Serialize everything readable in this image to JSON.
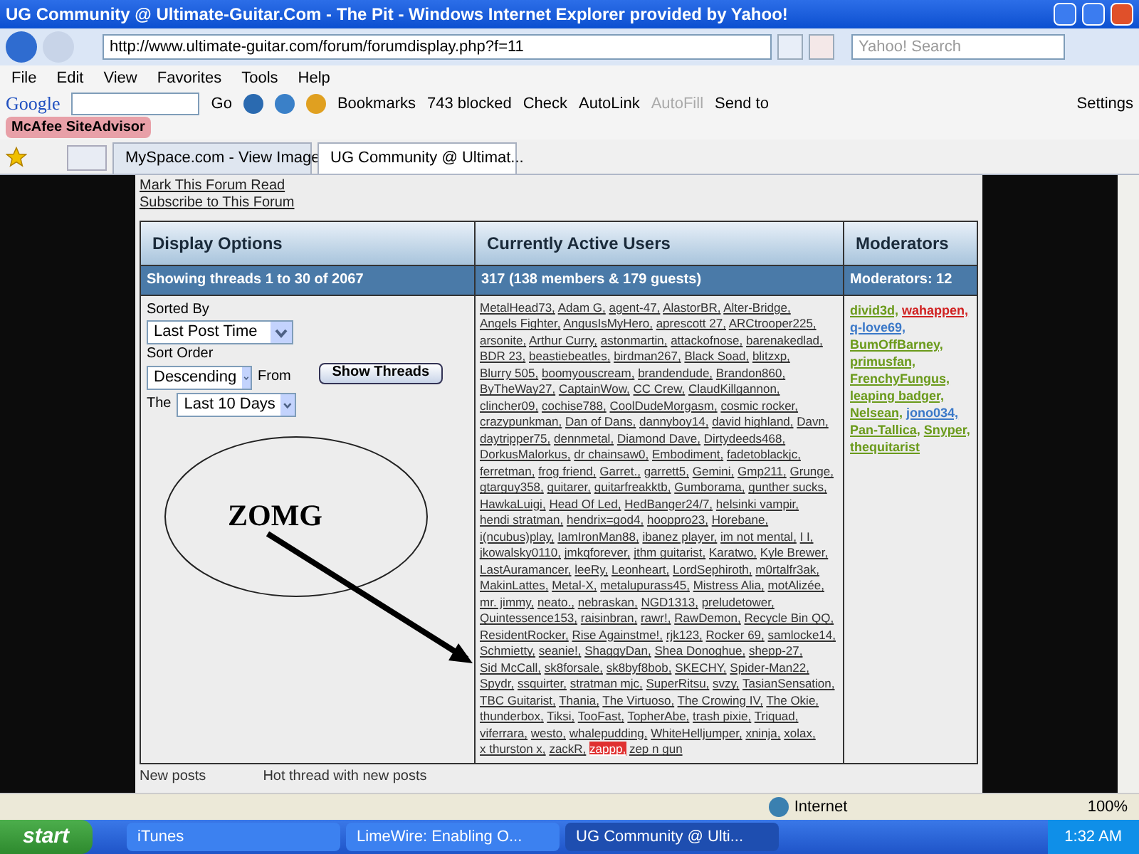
{
  "window": {
    "title": "UG Community @ Ultimate-Guitar.Com - The Pit - Windows Internet Explorer provided by Yahoo!"
  },
  "address_bar": {
    "url": "http://www.ultimate-guitar.com/forum/forumdisplay.php?f=11",
    "search_placeholder": "Yahoo! Search"
  },
  "menu": [
    "File",
    "Edit",
    "View",
    "Favorites",
    "Tools",
    "Help"
  ],
  "google_toolbar": {
    "logo": "Google",
    "go": "Go",
    "items": [
      {
        "label": "Bookmarks",
        "disabled": false
      },
      {
        "label": "743 blocked",
        "disabled": false
      },
      {
        "label": "Check",
        "disabled": false
      },
      {
        "label": "AutoLink",
        "disabled": false
      },
      {
        "label": "AutoFill",
        "disabled": true
      },
      {
        "label": "Send to",
        "disabled": false
      }
    ],
    "settings": "Settings"
  },
  "mcafee": "McAfee SiteAdvisor",
  "tabs": [
    {
      "label": "MySpace.com - View Image",
      "selected": false
    },
    {
      "label": "UG Community @ Ultimat...",
      "selected": true
    }
  ],
  "forum": {
    "links": [
      "Mark This Forum Read",
      "Subscribe to This Forum"
    ],
    "columns": [
      {
        "title": "Display Options",
        "sub": "Showing threads 1 to 30 of 2067"
      },
      {
        "title": "Currently Active Users",
        "sub": "317 (138 members & 179 guests)"
      },
      {
        "title": "Moderators",
        "sub": "Moderators: 12"
      }
    ],
    "display_options": {
      "sorted_by_label": "Sorted By",
      "sorted_by": "Last Post Time",
      "sort_order_label": "Sort Order",
      "sort_order": "Descending",
      "from_label": "From",
      "the_label": "The",
      "range": "Last 10 Days",
      "button": "Show Threads"
    },
    "users": [
      {
        "name": "MetalHead73,"
      },
      {
        "name": "Adam G,"
      },
      {
        "name": "agent-47,"
      },
      {
        "name": "AlastorBR,"
      },
      {
        "name": "Alter-Bridge,"
      },
      {
        "name": "Angels Fighter,"
      },
      {
        "name": "AngusIsMyHero,"
      },
      {
        "name": "aprescott 27,"
      },
      {
        "name": "ARCtrooper225,"
      },
      {
        "name": "arsonite,"
      },
      {
        "name": "Arthur Curry,"
      },
      {
        "name": "astonmartin,"
      },
      {
        "name": "attackofnose,"
      },
      {
        "name": "barenakedlad,"
      },
      {
        "name": "BDR 23,"
      },
      {
        "name": "beastiebeatles,"
      },
      {
        "name": "birdman267,"
      },
      {
        "name": "Black Soad,"
      },
      {
        "name": "blitzxp,"
      },
      {
        "name": "Blurry 505,"
      },
      {
        "name": "boomyouscream,"
      },
      {
        "name": "brandendude,"
      },
      {
        "name": "Brandon860,"
      },
      {
        "name": "ByTheWay27,"
      },
      {
        "name": "CaptainWow,"
      },
      {
        "name": "CC Crew,"
      },
      {
        "name": "ClaudKillgannon,"
      },
      {
        "name": "clincher09,"
      },
      {
        "name": "cochise788,"
      },
      {
        "name": "CoolDudeMorgasm,"
      },
      {
        "name": "cosmic rocker,"
      },
      {
        "name": "crazypunkman,"
      },
      {
        "name": "Dan of Dans,"
      },
      {
        "name": "dannyboy14,"
      },
      {
        "name": "david highland,"
      },
      {
        "name": "Davn,"
      },
      {
        "name": "daytripper75,"
      },
      {
        "name": "dennmetal,"
      },
      {
        "name": "Diamond Dave,"
      },
      {
        "name": "Dirtydeeds468,"
      },
      {
        "name": "DorkusMalorkus,"
      },
      {
        "name": "dr chainsaw0,"
      },
      {
        "name": "Embodiment,"
      },
      {
        "name": "fadetoblackjc,"
      },
      {
        "name": "ferretman,"
      },
      {
        "name": "frog friend,"
      },
      {
        "name": "Garret.,"
      },
      {
        "name": "garrett5,"
      },
      {
        "name": "Gemini,"
      },
      {
        "name": "Gmp211,"
      },
      {
        "name": "Grunge,"
      },
      {
        "name": "gtarguy358,"
      },
      {
        "name": "guitarer,"
      },
      {
        "name": "guitarfreakktb,"
      },
      {
        "name": "Gumborama,"
      },
      {
        "name": "gunther sucks,"
      },
      {
        "name": "HawkaLuigi,"
      },
      {
        "name": "Head Of Led,"
      },
      {
        "name": "HedBanger24/7,"
      },
      {
        "name": "helsinki vampir,"
      },
      {
        "name": "hendi stratman,"
      },
      {
        "name": "hendrix=god4,"
      },
      {
        "name": "hooppro23,"
      },
      {
        "name": "Horebane,"
      },
      {
        "name": "i(ncubus)play,"
      },
      {
        "name": "IamIronMan88,"
      },
      {
        "name": "ibanez player,"
      },
      {
        "name": "im not mental,"
      },
      {
        "name": "I I,"
      },
      {
        "name": "jkowalsky0110,"
      },
      {
        "name": "jmkqforever,"
      },
      {
        "name": "jthm guitarist,"
      },
      {
        "name": "Karatwo,"
      },
      {
        "name": "Kyle Brewer,"
      },
      {
        "name": "LastAuramancer,"
      },
      {
        "name": "leeRy,"
      },
      {
        "name": "Leonheart,"
      },
      {
        "name": "LordSephiroth,"
      },
      {
        "name": "m0rtalfr3ak,"
      },
      {
        "name": "MakinLattes,"
      },
      {
        "name": "Metal-X,"
      },
      {
        "name": "metalupurass45,"
      },
      {
        "name": "Mistress Alia,"
      },
      {
        "name": "motAlizée,"
      },
      {
        "name": "mr. jimmy,"
      },
      {
        "name": "neato.,"
      },
      {
        "name": "nebraskan,"
      },
      {
        "name": "NGD1313,"
      },
      {
        "name": "preludetower,"
      },
      {
        "name": "Quintessence153,"
      },
      {
        "name": "raisinbran,"
      },
      {
        "name": "rawr!,"
      },
      {
        "name": "RawDemon,"
      },
      {
        "name": "Recycle Bin QQ,"
      },
      {
        "name": "ResidentRocker,"
      },
      {
        "name": "Rise Againstme!,"
      },
      {
        "name": "rjk123,"
      },
      {
        "name": "Rocker 69,"
      },
      {
        "name": "samlocke14,"
      },
      {
        "name": "Schmietty,"
      },
      {
        "name": "seanie!,"
      },
      {
        "name": "ShaggyDan,"
      },
      {
        "name": "Shea Donoghue,"
      },
      {
        "name": "shepp-27,"
      },
      {
        "name": "Sid McCall,"
      },
      {
        "name": "sk8forsale,"
      },
      {
        "name": "sk8byf8bob,"
      },
      {
        "name": "SKECHY,"
      },
      {
        "name": "Spider-Man22,"
      },
      {
        "name": "Spydr,"
      },
      {
        "name": "ssquirter,"
      },
      {
        "name": "stratman mjc,"
      },
      {
        "name": "SuperRitsu,"
      },
      {
        "name": "svzy,"
      },
      {
        "name": "TasianSensation,"
      },
      {
        "name": "TBC Guitarist,"
      },
      {
        "name": "Thania,"
      },
      {
        "name": "The Virtuoso,"
      },
      {
        "name": "The Crowing IV,"
      },
      {
        "name": "The Okie,"
      },
      {
        "name": "thunderbox,"
      },
      {
        "name": "Tiksi,"
      },
      {
        "name": "TooFast,"
      },
      {
        "name": "TopherAbe,"
      },
      {
        "name": "trash pixie,"
      },
      {
        "name": "Triquad,"
      },
      {
        "name": "viferrara,"
      },
      {
        "name": "westo,"
      },
      {
        "name": "whalepudding,"
      },
      {
        "name": "WhiteHelljumper,"
      },
      {
        "name": "xninja,"
      },
      {
        "name": "xolax,"
      },
      {
        "name": "x thurston x,"
      },
      {
        "name": "zackR,"
      },
      {
        "name": "zappp,",
        "color": "#e03030"
      },
      {
        "name": "zep n gun"
      }
    ],
    "moderators": [
      {
        "name": "divid3d,",
        "color": "#6a9a1a"
      },
      {
        "name": "wahappen,",
        "color": "#d02020"
      },
      {
        "name": "q-love69,",
        "color": "#3a78c8"
      },
      {
        "name": "BumOffBarney,",
        "color": "#6a9a1a"
      },
      {
        "name": "primusfan,",
        "color": "#6a9a1a"
      },
      {
        "name": "FrenchyFungus,",
        "color": "#6a9a1a"
      },
      {
        "name": "leaping badger,",
        "color": "#6a9a1a"
      },
      {
        "name": "Nelsean,",
        "color": "#6a9a1a"
      },
      {
        "name": "jono034,",
        "color": "#3a78c8"
      },
      {
        "name": "Pan-Tallica,",
        "color": "#6a9a1a"
      },
      {
        "name": "Snyper,",
        "color": "#6a9a1a"
      },
      {
        "name": "thequitarist",
        "color": "#6a9a1a"
      }
    ],
    "annotation": "ZOMG",
    "legend": [
      "New posts",
      "Hot thread with new posts"
    ]
  },
  "status_bar": {
    "zone": "Internet",
    "zoom": "100%"
  },
  "taskbar": {
    "start": "start",
    "items": [
      {
        "label": "iTunes",
        "selected": false
      },
      {
        "label": "LimeWire: Enabling O...",
        "selected": false
      },
      {
        "label": "UG Community @ Ulti...",
        "selected": true
      }
    ],
    "clock": "1:32 AM"
  }
}
